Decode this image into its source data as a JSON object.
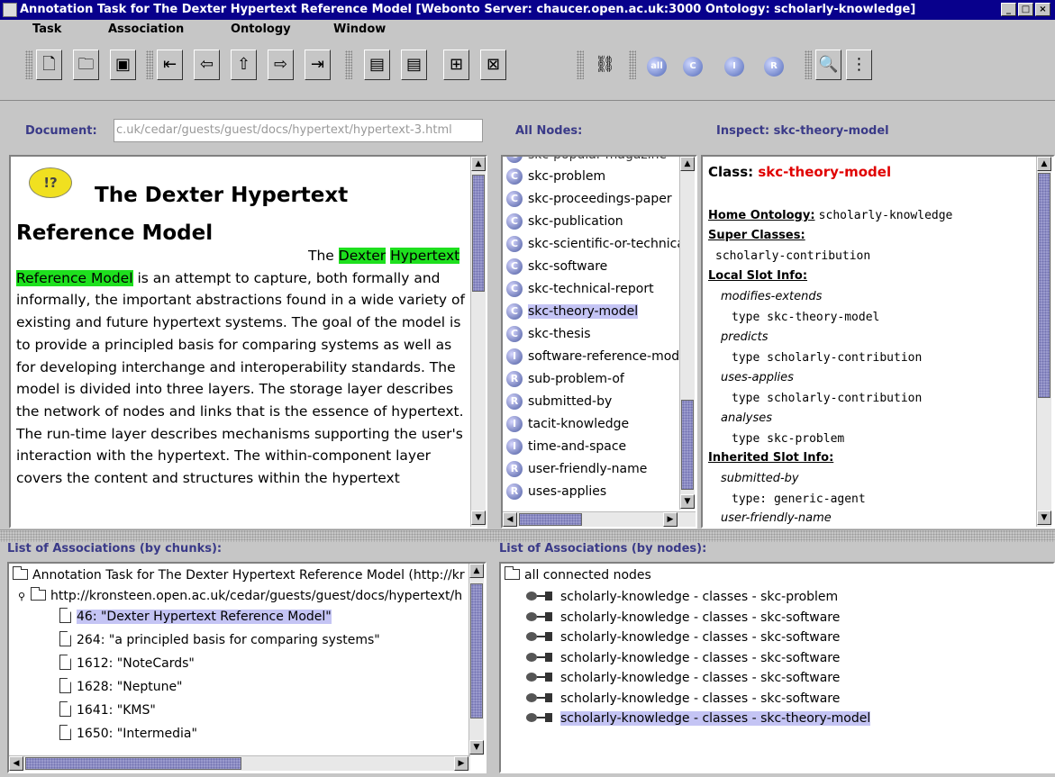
{
  "window": {
    "title": "Annotation Task for The Dexter Hypertext Reference Model [Webonto Server: chaucer.open.ac.uk:3000  Ontology: scholarly-knowledge]",
    "buttons": [
      "_",
      "□",
      "X"
    ]
  },
  "menubar": {
    "items": [
      "Task",
      "Association",
      "Ontology",
      "Window"
    ]
  },
  "toolbar": {
    "icons": [
      "new-document-icon",
      "open-folder-icon",
      "save-icon",
      "first-icon",
      "back-icon",
      "up-icon",
      "forward-icon",
      "last-icon",
      "document-icon",
      "document-red-icon",
      "tree-add-icon",
      "tree-remove-icon",
      "network-icon",
      "all-icon",
      "class-icon",
      "instance-icon",
      "relation-icon",
      "search-icon",
      "hierarchy-icon"
    ],
    "circle_labels": [
      "all",
      "C",
      "I",
      "R"
    ]
  },
  "document_panel": {
    "label": "Document:",
    "url": "c.uk/cedar/guests/guest/docs/hypertext/hypertext-3.html",
    "title_line1": "The Dexter Hypertext",
    "title_line2": "Reference Model",
    "intro_the": "The ",
    "hl1": "Dexter",
    "hl2": "Hypertext Reference Model",
    "body_rest": " is an attempt to capture, both formally and informally, the important abstractions found in a wide variety of existing and future hypertext systems. The goal of the model is to provide a principled basis for comparing systems as well as for developing interchange and interoperability standards. The model is divided into three layers. The storage layer describes the network of nodes and links that is the essence of hypertext. The run-time layer describes mechanisms supporting the user's interaction with the hypertext. The within-component layer covers the content and structures within the hypertext",
    "icon_text": "!?"
  },
  "nodes_panel": {
    "label": "All Nodes:",
    "partial_top": "skc-popular-magazine",
    "items": [
      {
        "type": "C",
        "name": "skc-problem"
      },
      {
        "type": "C",
        "name": "skc-proceedings-paper"
      },
      {
        "type": "C",
        "name": "skc-publication"
      },
      {
        "type": "C",
        "name": "skc-scientific-or-technical"
      },
      {
        "type": "C",
        "name": "skc-software"
      },
      {
        "type": "C",
        "name": "skc-technical-report"
      },
      {
        "type": "C",
        "name": "skc-theory-model",
        "selected": true
      },
      {
        "type": "C",
        "name": "skc-thesis"
      },
      {
        "type": "I",
        "name": "software-reference-model"
      },
      {
        "type": "R",
        "name": "sub-problem-of"
      },
      {
        "type": "R",
        "name": "submitted-by"
      },
      {
        "type": "I",
        "name": "tacit-knowledge"
      },
      {
        "type": "I",
        "name": "time-and-space"
      },
      {
        "type": "R",
        "name": "user-friendly-name"
      },
      {
        "type": "R",
        "name": "uses-applies"
      }
    ]
  },
  "inspect_panel": {
    "label": "Inspect: skc-theory-model",
    "class_label": "Class: ",
    "class_name": "skc-theory-model",
    "home_ontology_label": "Home Ontology:",
    "home_ontology": "scholarly-knowledge",
    "super_classes_label": "Super Classes:",
    "super_class": "scholarly-contribution",
    "local_slot_label": "Local Slot Info:",
    "slots": [
      {
        "name": "modifies-extends",
        "type": "type skc-theory-model"
      },
      {
        "name": "predicts",
        "type": "type scholarly-contribution"
      },
      {
        "name": "uses-applies",
        "type": "type scholarly-contribution"
      },
      {
        "name": "analyses",
        "type": "type skc-problem"
      }
    ],
    "inherited_label": "Inherited Slot Info:",
    "inherited": [
      {
        "name": "submitted-by",
        "type": "type: generic-agent"
      },
      {
        "name": "user-friendly-name",
        "type": ""
      }
    ]
  },
  "chunks_panel": {
    "label": "List of Associations (by chunks):",
    "root": "Annotation Task for The Dexter Hypertext Reference Model (http://kr",
    "url_node": "http://kronsteen.open.ac.uk/cedar/guests/guest/docs/hypertext/h",
    "chunks": [
      {
        "text": "46: \"Dexter Hypertext Reference Model\"",
        "selected": true
      },
      {
        "text": "264: \"a principled basis for comparing systems\""
      },
      {
        "text": "1612: \"NoteCards\""
      },
      {
        "text": "1628: \"Neptune\""
      },
      {
        "text": "1641: \"KMS\""
      },
      {
        "text": "1650: \"Intermedia\""
      }
    ]
  },
  "assoc_nodes_panel": {
    "label": "List of Associations (by nodes):",
    "root": "all connected nodes",
    "items": [
      {
        "text": "scholarly-knowledge - classes - skc-problem"
      },
      {
        "text": "scholarly-knowledge - classes - skc-software"
      },
      {
        "text": "scholarly-knowledge - classes - skc-software"
      },
      {
        "text": "scholarly-knowledge - classes - skc-software"
      },
      {
        "text": "scholarly-knowledge - classes - skc-software"
      },
      {
        "text": "scholarly-knowledge - classes - skc-software"
      },
      {
        "text": "scholarly-knowledge - classes - skc-theory-model",
        "selected": true
      }
    ]
  },
  "colors": {
    "title_bar": "#08008c",
    "highlight_green": "#1ee01e",
    "selection": "#c4c4f4",
    "class_red": "#e00000",
    "panel_label": "#3a3a88"
  }
}
